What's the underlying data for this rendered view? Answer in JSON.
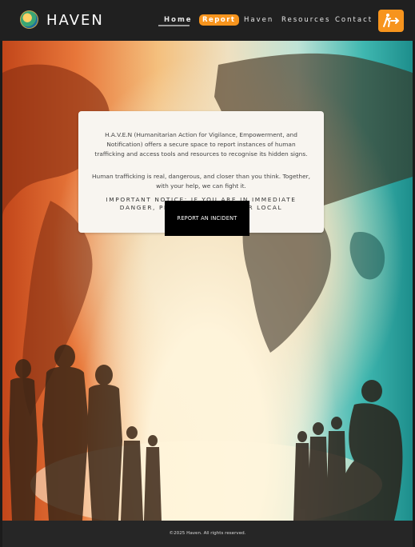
{
  "header": {
    "brand": "HAVEN",
    "nav": [
      {
        "label": "Home"
      },
      {
        "label": "Report"
      },
      {
        "label": "Haven"
      },
      {
        "label": "Resources"
      },
      {
        "label": "Contact"
      }
    ],
    "accent_color": "#f7941d"
  },
  "hero": {
    "intro": "H.A.V.E.N (Humanitarian Action for Vigilance, Empowerment, and Notification) offers a secure space to report instances of human trafficking and access tools and resources to recognise its hidden signs.",
    "tagline": "Human trafficking is real, dangerous, and closer than you think. Together, with your help, we can fight it.",
    "notice": "IMPORTANT NOTICE: IF YOU ARE IN IMMEDIATE DANGER, PLEASE CONTACT YOUR LOCAL AUTHORITIES.",
    "report_button": "REPORT AN INCIDENT"
  },
  "footer": {
    "copyright": "©2025 Haven. All rights reserved."
  },
  "icons": {
    "logo": "globe-logo-icon",
    "quick_exit": "quick-exit-icon"
  }
}
